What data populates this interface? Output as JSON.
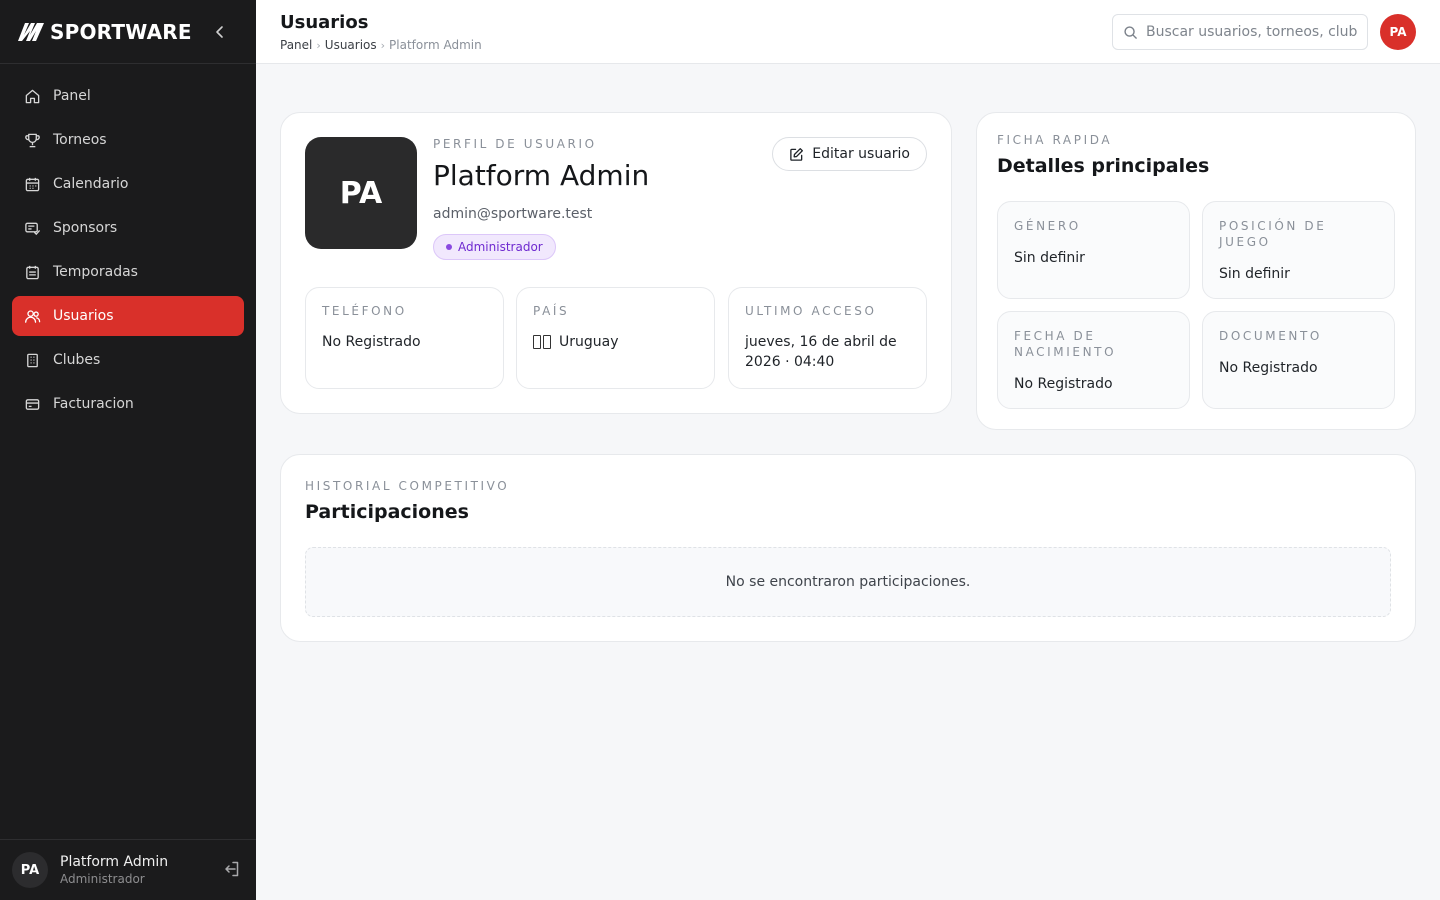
{
  "brand": {
    "name": "SPORTWARE"
  },
  "sidebar": {
    "items": [
      {
        "label": "Panel",
        "icon": "home-icon"
      },
      {
        "label": "Torneos",
        "icon": "trophy-icon"
      },
      {
        "label": "Calendario",
        "icon": "calendar-icon"
      },
      {
        "label": "Sponsors",
        "icon": "sponsors-icon"
      },
      {
        "label": "Temporadas",
        "icon": "calendar-list-icon"
      },
      {
        "label": "Usuarios",
        "icon": "users-icon",
        "active": true
      },
      {
        "label": "Clubes",
        "icon": "building-icon"
      },
      {
        "label": "Facturacion",
        "icon": "billing-icon"
      }
    ],
    "footer": {
      "initials": "PA",
      "name": "Platform Admin",
      "role": "Administrador"
    }
  },
  "header": {
    "title": "Usuarios",
    "breadcrumb": [
      "Panel",
      "Usuarios",
      "Platform Admin"
    ],
    "search_placeholder": "Buscar usuarios, torneos, clubes...",
    "avatar_initials": "PA"
  },
  "profile": {
    "eyebrow": "PERFIL DE USUARIO",
    "initials": "PA",
    "name": "Platform Admin",
    "email": "admin@sportware.test",
    "role_badge": "Administrador",
    "edit_label": "Editar usuario",
    "fields": {
      "phone": {
        "label": "TELÉFONO",
        "value": "No Registrado"
      },
      "country": {
        "label": "PAÍS",
        "value": "Uruguay"
      },
      "last_access": {
        "label": "ULTIMO ACCESO",
        "value": "jueves, 16 de abril de 2026 · 04:40"
      }
    }
  },
  "quick": {
    "eyebrow": "FICHA RAPIDA",
    "title": "Detalles principales",
    "gender": {
      "label": "GÉNERO",
      "value": "Sin definir"
    },
    "position": {
      "label": "POSICIÓN DE JUEGO",
      "value": "Sin definir"
    },
    "birthdate": {
      "label": "FECHA DE NACIMIENTO",
      "value": "No Registrado"
    },
    "document": {
      "label": "DOCUMENTO",
      "value": "No Registrado"
    }
  },
  "history": {
    "eyebrow": "HISTORIAL COMPETITIVO",
    "title": "Participaciones",
    "empty_message": "No se encontraron participaciones."
  },
  "colors": {
    "accent": "#d9302a",
    "sidebar_bg": "#1b1b1c",
    "badge_purple": "#6f2ad0"
  }
}
